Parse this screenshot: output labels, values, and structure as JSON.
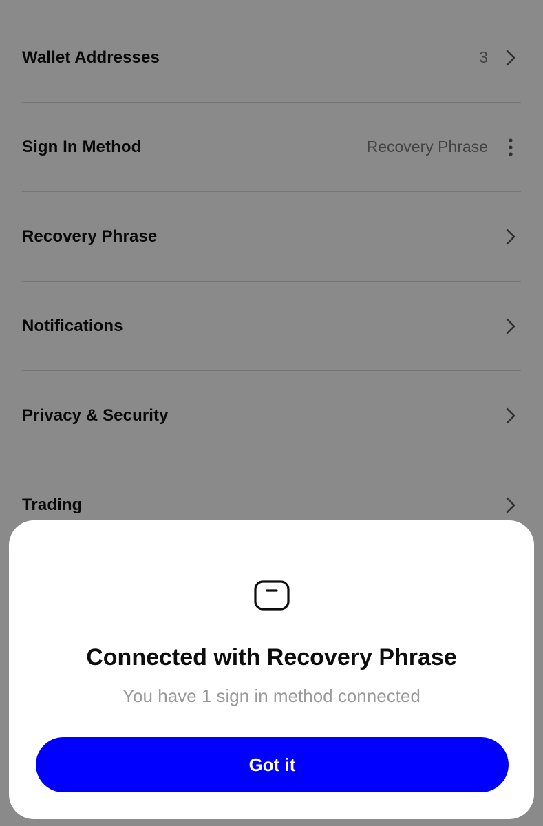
{
  "settings": {
    "items": [
      {
        "label": "Wallet Addresses",
        "value": "3"
      },
      {
        "label": "Sign In Method",
        "value": "Recovery Phrase"
      },
      {
        "label": "Recovery Phrase",
        "value": ""
      },
      {
        "label": "Notifications",
        "value": ""
      },
      {
        "label": "Privacy & Security",
        "value": ""
      },
      {
        "label": "Trading",
        "value": ""
      }
    ]
  },
  "sheet": {
    "icon": "connection-card-icon",
    "title": "Connected with Recovery Phrase",
    "subtitle": "You have 1 sign in method connected",
    "button_label": "Got it"
  },
  "colors": {
    "accent": "#0000FF",
    "overlay": "#000000",
    "muted_text": "#9A9A9A"
  }
}
